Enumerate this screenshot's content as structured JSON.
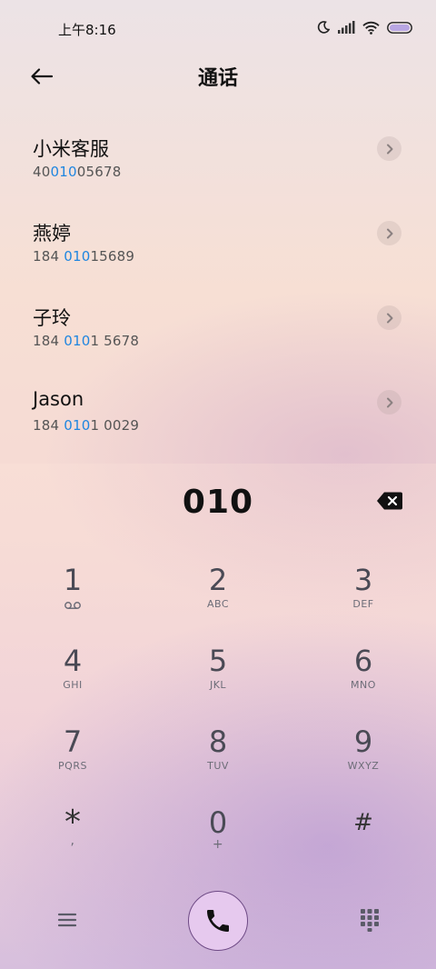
{
  "status": {
    "time": "上午8:16"
  },
  "header": {
    "title": "通话"
  },
  "results": [
    {
      "name": "小米客服",
      "number_pre": "40",
      "number_hl": "010",
      "number_post": "05678"
    },
    {
      "name": "燕婷",
      "number_pre": "184 ",
      "number_hl": "010",
      "number_post": "15689"
    },
    {
      "name": "子玲",
      "number_pre": "184 ",
      "number_hl": "010",
      "number_post": "1 5678"
    },
    {
      "name": "Jason",
      "number_pre": "184 ",
      "number_hl": "010",
      "number_post": "1 0029"
    }
  ],
  "dialer": {
    "display": "010",
    "keys": [
      {
        "digit": "1",
        "letters": ""
      },
      {
        "digit": "2",
        "letters": "ABC"
      },
      {
        "digit": "3",
        "letters": "DEF"
      },
      {
        "digit": "4",
        "letters": "GHI"
      },
      {
        "digit": "5",
        "letters": "JKL"
      },
      {
        "digit": "6",
        "letters": "MNO"
      },
      {
        "digit": "7",
        "letters": "PQRS"
      },
      {
        "digit": "8",
        "letters": "TUV"
      },
      {
        "digit": "9",
        "letters": "WXYZ"
      },
      {
        "digit": "*",
        "letters": ","
      },
      {
        "digit": "0",
        "letters": "+"
      },
      {
        "digit": "#",
        "letters": ""
      }
    ]
  },
  "colors": {
    "highlight": "#1f86e0",
    "call_button": "#e6c9ee"
  },
  "icons": {
    "back": "arrow-left-icon",
    "detail": "chevron-right-icon",
    "backspace": "backspace-icon",
    "voicemail": "voicemail-icon",
    "menu": "menu-icon",
    "call": "phone-icon",
    "keypad": "dialpad-icon"
  }
}
